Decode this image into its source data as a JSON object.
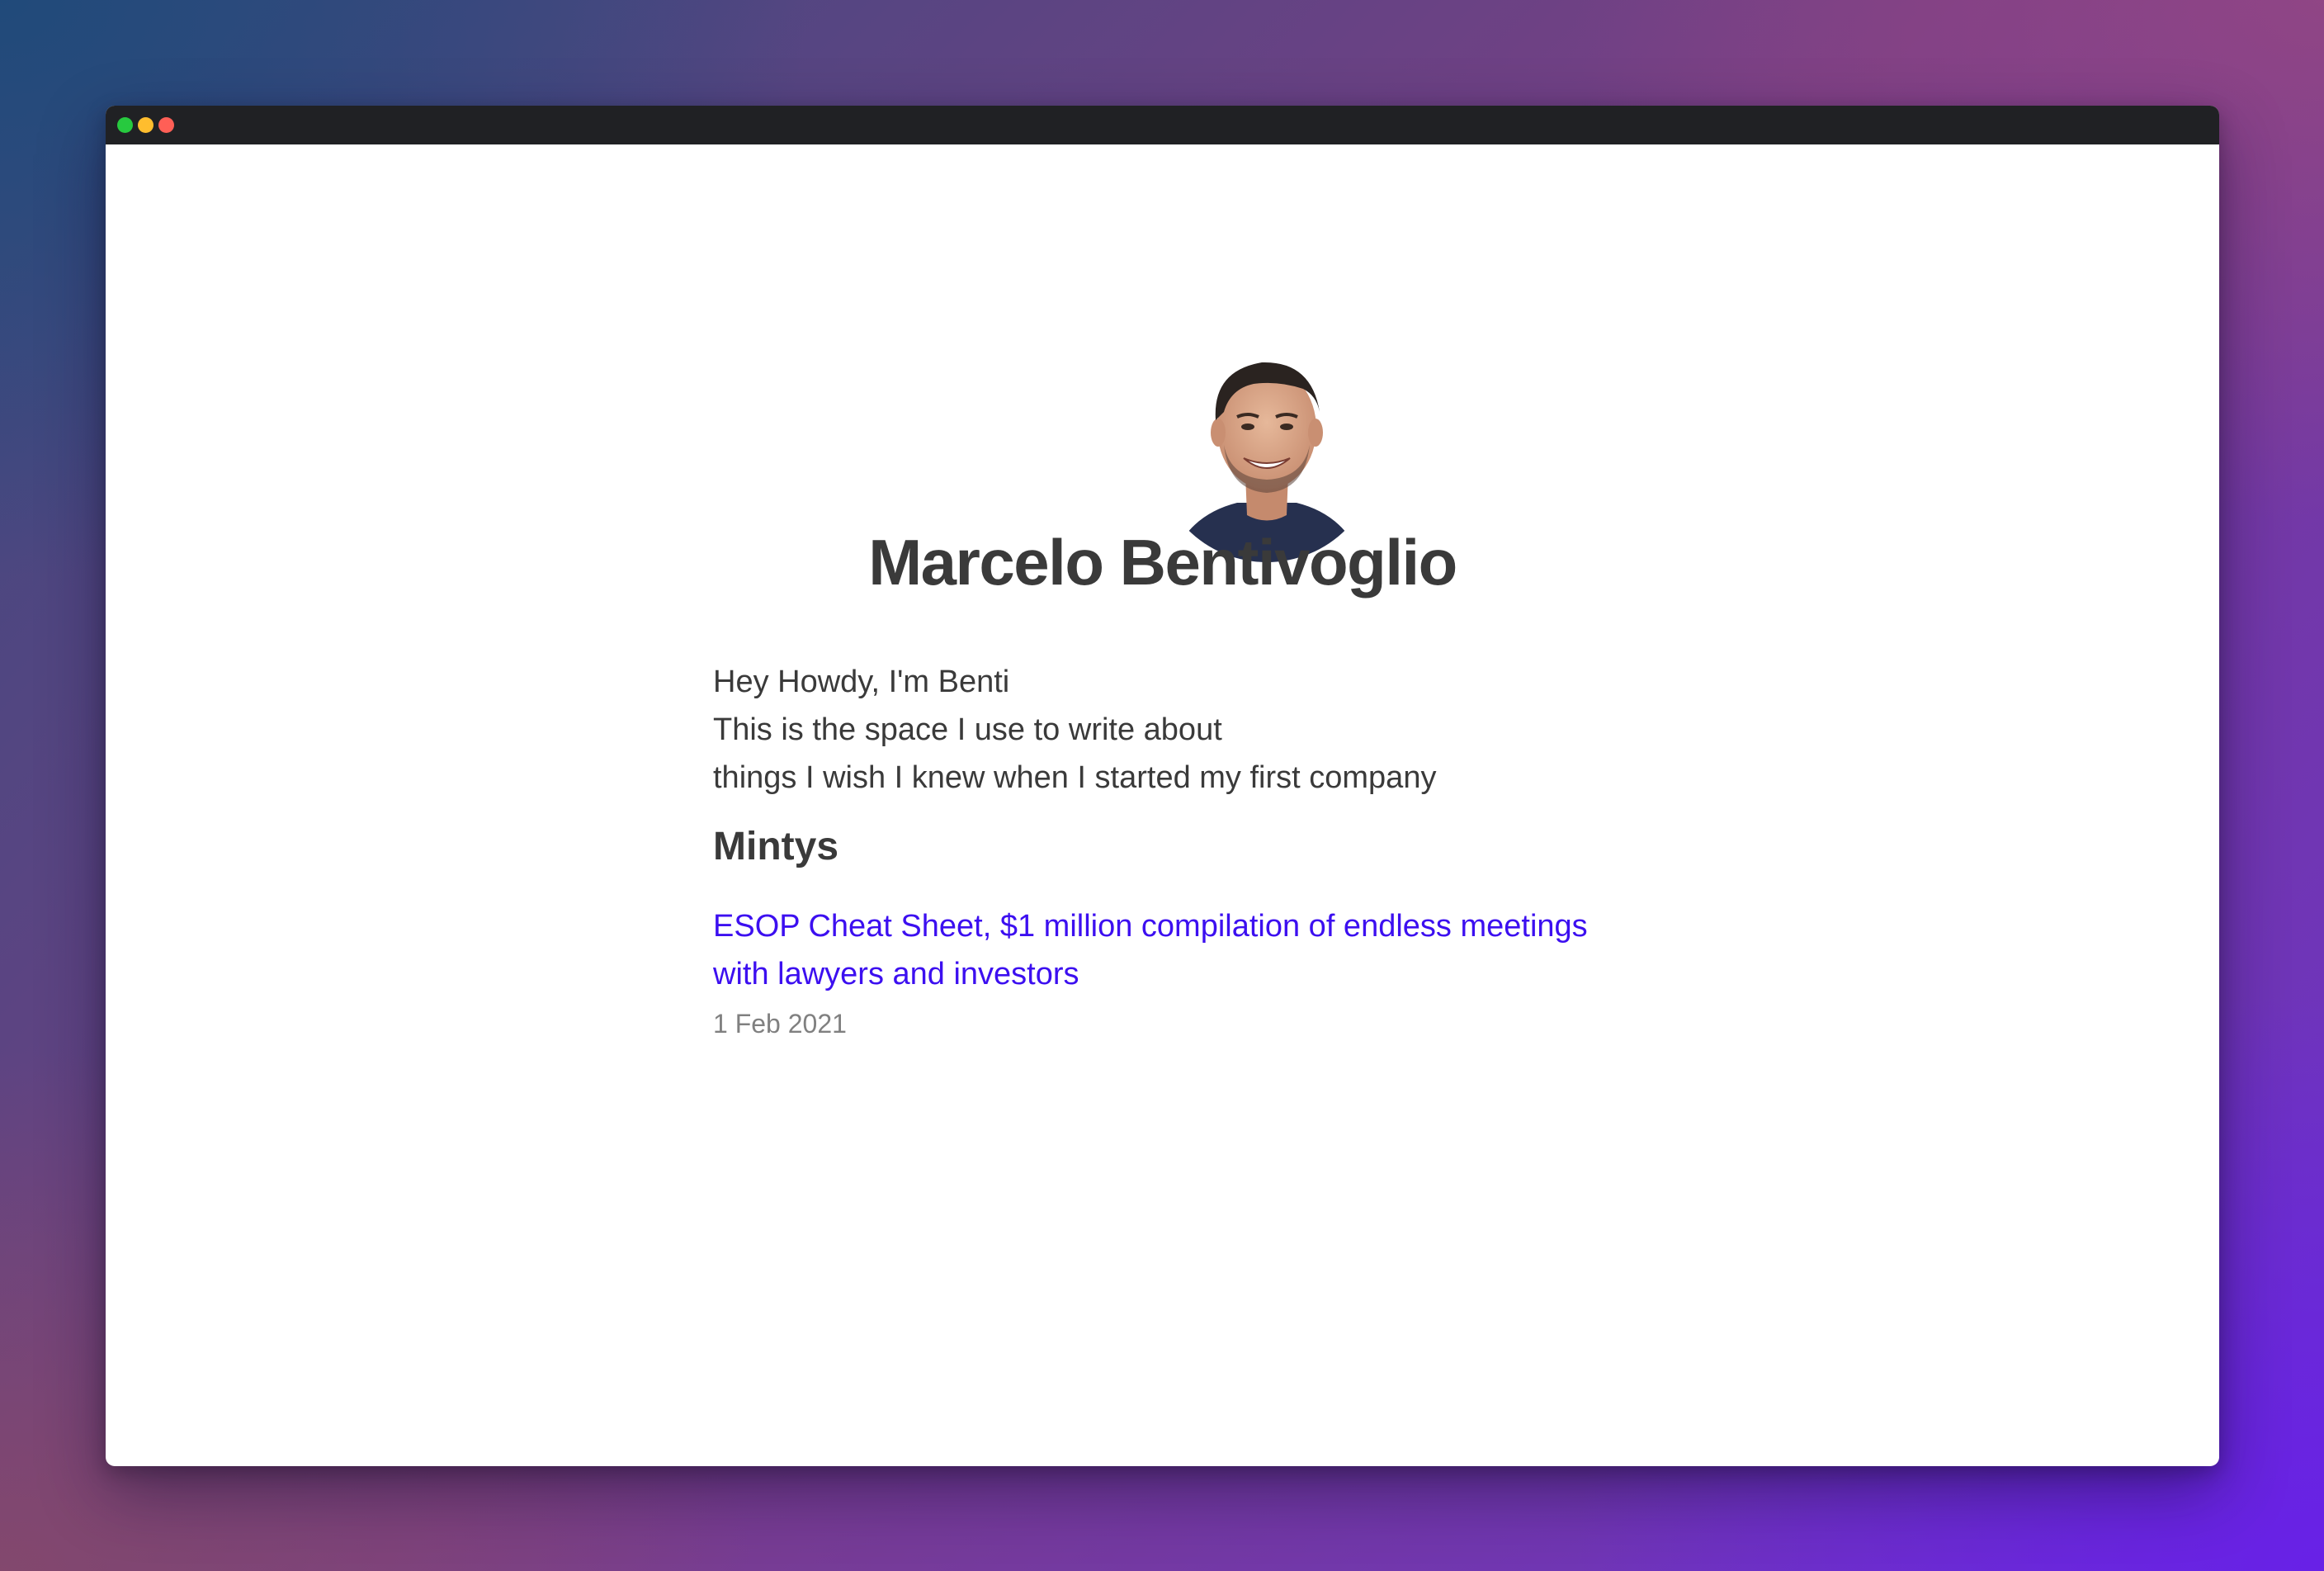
{
  "window": {
    "controls": [
      "green",
      "yellow",
      "red"
    ]
  },
  "profile": {
    "avatar_icon": "avatar-photo",
    "name": "Marcelo Bentivoglio"
  },
  "intro": {
    "lines": [
      "Hey Howdy, I'm Benti",
      "This is the space I use to write about",
      "things I wish I knew when I started my first company"
    ]
  },
  "section": {
    "title": "Mintys"
  },
  "posts": [
    {
      "title": "ESOP Cheat Sheet, $1 million compilation of endless meetings with lawyers and investors",
      "date": "1 Feb 2021"
    }
  ],
  "colors": {
    "link": "#3c0ff0",
    "text": "#3a3a3a",
    "muted": "#808080",
    "titlebar": "#202124"
  }
}
